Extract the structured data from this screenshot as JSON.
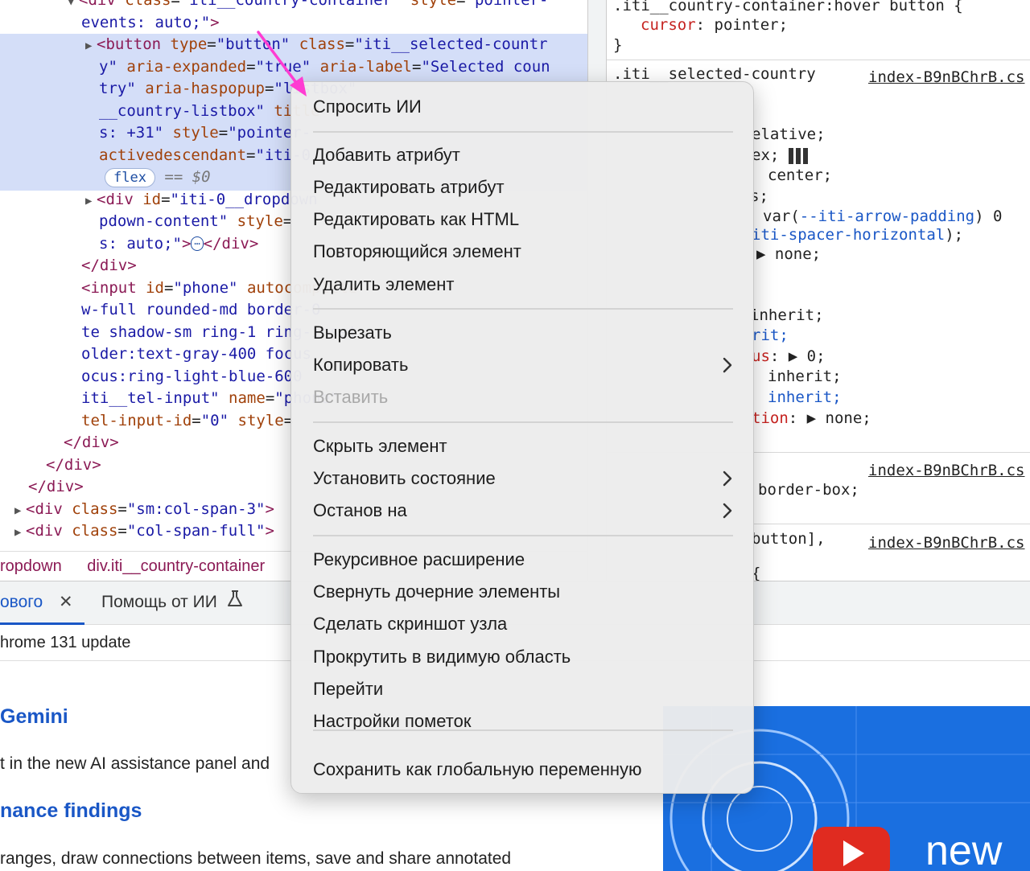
{
  "elements": {
    "lines": [
      {
        "html_parts": [
          [
            "tri",
            "▼"
          ],
          [
            "tag",
            "<div "
          ],
          [
            "attr",
            "class"
          ],
          [
            "txt",
            "="
          ],
          [
            "val",
            "\"iti__country-container\""
          ],
          [
            "txt",
            " "
          ],
          [
            "attr",
            "style"
          ],
          [
            "txt",
            "="
          ],
          [
            "val",
            "\"pointer-"
          ]
        ]
      },
      {
        "html_parts": [
          [
            "val",
            "events: auto;\""
          ],
          [
            "tag",
            ">"
          ]
        ]
      },
      {
        "html_parts": [
          [
            "tri",
            "▶"
          ],
          [
            "tag",
            "<button "
          ],
          [
            "attr",
            "type"
          ],
          [
            "txt",
            "="
          ],
          [
            "val",
            "\"button\""
          ],
          [
            "txt",
            " "
          ],
          [
            "attr",
            "class"
          ],
          [
            "txt",
            "="
          ],
          [
            "val",
            "\"iti__selected-countr"
          ]
        ]
      },
      {
        "html_parts": [
          [
            "val",
            "y\""
          ],
          [
            "txt",
            " "
          ],
          [
            "attr",
            "aria-expanded"
          ],
          [
            "txt",
            "="
          ],
          [
            "val",
            "\"true\""
          ],
          [
            "txt",
            " "
          ],
          [
            "attr",
            "aria-label"
          ],
          [
            "txt",
            "="
          ],
          [
            "val",
            "\"Selected coun"
          ]
        ]
      },
      {
        "html_parts": [
          [
            "val",
            "try\""
          ],
          [
            "txt",
            " "
          ],
          [
            "attr",
            "aria-haspopup"
          ],
          [
            "txt",
            "="
          ],
          [
            "val",
            "\"listbox\""
          ]
        ]
      },
      {
        "html_parts": [
          [
            "val",
            "__country-listbox\""
          ],
          [
            "txt",
            " "
          ],
          [
            "attr",
            "title"
          ]
        ]
      },
      {
        "html_parts": [
          [
            "val",
            "s: +31\""
          ],
          [
            "txt",
            " "
          ],
          [
            "attr",
            "style"
          ],
          [
            "txt",
            "="
          ],
          [
            "val",
            "\"pointer-"
          ]
        ]
      },
      {
        "html_parts": [
          [
            "attr",
            "activedescendant"
          ],
          [
            "txt",
            "="
          ],
          [
            "val",
            "\"iti-0"
          ]
        ]
      },
      {
        "html_parts": []
      },
      {
        "html_parts": [
          [
            "tri",
            "▶"
          ],
          [
            "tag",
            "<div "
          ],
          [
            "attr",
            "id"
          ],
          [
            "txt",
            "="
          ],
          [
            "val",
            "\"iti-0__dropdown"
          ]
        ]
      },
      {
        "html_parts": [
          [
            "val",
            "pdown-content\""
          ],
          [
            "txt",
            " "
          ],
          [
            "attr",
            "style"
          ],
          [
            "txt",
            "="
          ]
        ]
      },
      {
        "html_parts": [
          [
            "val",
            "s: auto;\""
          ],
          [
            "tag",
            ">"
          ]
        ]
      },
      {
        "html_parts": [
          [
            "tag",
            "</div>"
          ]
        ]
      },
      {
        "html_parts": [
          [
            "tag",
            "<input "
          ],
          [
            "attr",
            "id"
          ],
          [
            "txt",
            "="
          ],
          [
            "val",
            "\"phone\""
          ],
          [
            "txt",
            " "
          ],
          [
            "attr",
            "autocomplete"
          ]
        ]
      },
      {
        "html_parts": [
          [
            "val",
            "w-full rounded-md border-0"
          ]
        ]
      },
      {
        "html_parts": [
          [
            "val",
            "te shadow-sm ring-1 ring-inset"
          ]
        ]
      },
      {
        "html_parts": [
          [
            "val",
            "older:text-gray-400 focus"
          ]
        ]
      },
      {
        "html_parts": [
          [
            "val",
            "ocus:ring-light-blue-600"
          ]
        ]
      },
      {
        "html_parts": [
          [
            "val",
            "iti__tel-input\""
          ],
          [
            "txt",
            " "
          ],
          [
            "attr",
            "name"
          ],
          [
            "txt",
            "="
          ],
          [
            "val",
            "\"phone\""
          ]
        ]
      },
      {
        "html_parts": [
          [
            "attr",
            "tel-input-id"
          ],
          [
            "txt",
            "="
          ],
          [
            "val",
            "\"0\""
          ],
          [
            "txt",
            " "
          ],
          [
            "attr",
            "style"
          ],
          [
            "txt",
            "="
          ]
        ]
      },
      {
        "html_parts": [
          [
            "tag",
            "</div>"
          ]
        ]
      },
      {
        "html_parts": [
          [
            "tag",
            "</div>"
          ]
        ]
      },
      {
        "html_parts": [
          [
            "tag",
            "</div>"
          ]
        ]
      },
      {
        "html_parts": [
          [
            "tri",
            "▶"
          ],
          [
            "tag",
            "<div "
          ],
          [
            "attr",
            "class"
          ],
          [
            "txt",
            "="
          ],
          [
            "val",
            "\"sm:col-span-3\""
          ],
          [
            "tag",
            ">"
          ]
        ]
      },
      {
        "html_parts": [
          [
            "tri",
            "▶"
          ],
          [
            "tag",
            "<div "
          ],
          [
            "attr",
            "class"
          ],
          [
            "txt",
            "="
          ],
          [
            "val",
            "\"col-span-full\""
          ],
          [
            "tag",
            ">"
          ]
        ]
      }
    ],
    "flex_badge": "flex",
    "dollar": "== $0",
    "ellipsis": "⋯",
    "close_div": "</div>"
  },
  "breadcrumb": [
    "ropdown",
    "div.iti__country-container"
  ],
  "styles": {
    "rule1_selector": ".iti__country-container:hover button {",
    "rule1_prop": "cursor",
    "rule1_value": "pointer;",
    "rule1_close": "}",
    "rule2_selector": ".iti__selected-country",
    "source_link": "index-B9nBChrB.cs",
    "frag1": "elative;",
    "frag2": "ex;",
    "frag3": "center;",
    "frag4": "s;",
    "frag5_pre": "var(",
    "frag5_var": "--iti-arrow-padding",
    "frag5_post": ") 0",
    "frag6_var": "iti-spacer-horizontal",
    "frag6_post": ");",
    "frag7": "none;",
    "frag8": "inherit;",
    "frag9": "rit;",
    "frag10_prop": "us",
    "frag10_val": "0;",
    "frag11": "inherit;",
    "frag12": "inherit;",
    "frag13_prop": "tion",
    "frag13_val": "none;",
    "frag14": "border-box;",
    "frag15": "button],",
    "frag16": "{"
  },
  "drawer": {
    "tabs": [
      {
        "label": "ового",
        "active": true
      },
      {
        "label": "Помощь от ИИ",
        "active": false
      }
    ],
    "close_icon": "✕",
    "subtitle": "hrome 131 update"
  },
  "news": {
    "heading1": "Gemini",
    "para1": "t in the new AI assistance panel and",
    "heading2": "nance findings",
    "para2": "ranges, draw connections between items, save and share annotated",
    "video_word": "new"
  },
  "context_menu": {
    "items": [
      {
        "label": "Спросить ИИ",
        "submenu": false,
        "disabled": false
      },
      {
        "label": "Добавить атрибут",
        "submenu": false,
        "disabled": false
      },
      {
        "label": "Редактировать атрибут",
        "submenu": false,
        "disabled": false
      },
      {
        "label": "Редактировать как HTML",
        "submenu": false,
        "disabled": false
      },
      {
        "label": "Повторяющийся элемент",
        "submenu": false,
        "disabled": false
      },
      {
        "label": "Удалить элемент",
        "submenu": false,
        "disabled": false
      },
      {
        "label": "Вырезать",
        "submenu": false,
        "disabled": false
      },
      {
        "label": "Копировать",
        "submenu": true,
        "disabled": false
      },
      {
        "label": "Вставить",
        "submenu": false,
        "disabled": true
      },
      {
        "label": "Скрыть элемент",
        "submenu": false,
        "disabled": false
      },
      {
        "label": "Установить состояние",
        "submenu": true,
        "disabled": false
      },
      {
        "label": "Останов на",
        "submenu": true,
        "disabled": false
      },
      {
        "label": "Рекурсивное расширение",
        "submenu": false,
        "disabled": false
      },
      {
        "label": "Свернуть дочерние элементы",
        "submenu": false,
        "disabled": false
      },
      {
        "label": "Сделать скриншот узла",
        "submenu": false,
        "disabled": false
      },
      {
        "label": "Прокрутить в видимую область",
        "submenu": false,
        "disabled": false
      },
      {
        "label": "Перейти",
        "submenu": false,
        "disabled": false
      },
      {
        "label": "Настройки пометок",
        "submenu": false,
        "disabled": false
      },
      {
        "label": "Сохранить как глобальную переменную",
        "submenu": false,
        "disabled": false
      }
    ],
    "chevron_icon": "›"
  },
  "colors": {
    "selection": "#d4def8",
    "accent": "#1a57c6",
    "arrow": "#ff3cd2"
  }
}
